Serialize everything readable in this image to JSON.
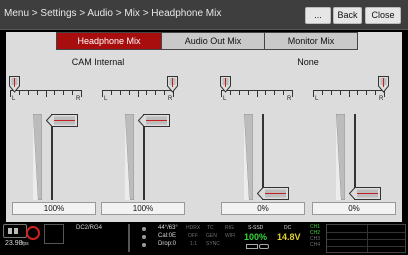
{
  "header": {
    "breadcrumb": "Menu > Settings > Audio > Mix > Headphone Mix",
    "more_label": "...",
    "back_label": "Back",
    "close_label": "Close"
  },
  "tabs": [
    {
      "label": "Headphone Mix",
      "active": true
    },
    {
      "label": "Audio Out Mix",
      "active": false
    },
    {
      "label": "Monitor Mix",
      "active": false
    }
  ],
  "sources": [
    {
      "name": "CAM Internal"
    },
    {
      "name": "None"
    }
  ],
  "channels": [
    {
      "level_label": "100%",
      "level": 1.0,
      "balance_l": "L",
      "balance_r": "R",
      "balance": -1.0
    },
    {
      "level_label": "100%",
      "level": 1.0,
      "balance_l": "L",
      "balance_r": "R",
      "balance": 1.0
    },
    {
      "level_label": "0%",
      "level": 0.0,
      "balance_l": "L",
      "balance_r": "R",
      "balance": -1.0
    },
    {
      "level_label": "0%",
      "level": 0.0,
      "balance_l": "L",
      "balance_r": "R",
      "balance": 1.0
    }
  ],
  "status_bar": {
    "fps": "23.98",
    "fps_unit": "fps",
    "format": "DC2/RG4",
    "shutter": "44°/63°",
    "cal": "Cal:0E",
    "drop": "Drop:0",
    "hdrx": "HDRX",
    "tc": "TC",
    "rig": "RIG",
    "off": "OFF",
    "gen": "GEN",
    "wifi": "WIFI",
    "ratio": "1:1",
    "sync": "SYNC",
    "media_label": "S-SSD",
    "media_value": "100%",
    "dc_label": "DC",
    "dc_value": "14.8V",
    "ch_labels": [
      "CH1",
      "CH2",
      "CH3",
      "CH4"
    ],
    "colors": {
      "green": "#37d437",
      "yellow": "#e0d030",
      "record_red": "#d02020"
    }
  },
  "colors": {
    "accent": "#a80e0e",
    "panel": "#dcdcdc",
    "header": "#3e3e3e"
  }
}
